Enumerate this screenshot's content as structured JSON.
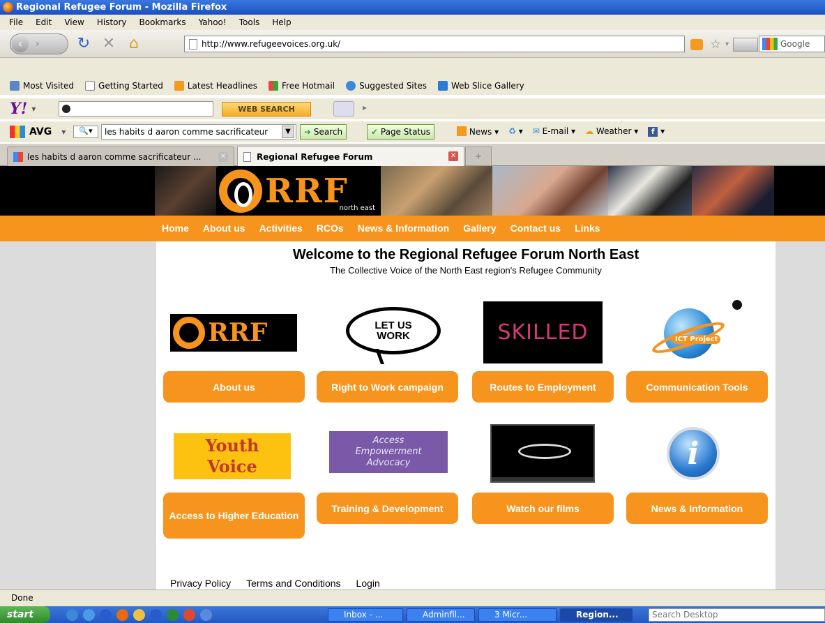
{
  "window": {
    "title": "Regional Refugee Forum - Mozilla Firefox"
  },
  "menu": [
    "File",
    "Edit",
    "View",
    "History",
    "Bookmarks",
    "Yahoo!",
    "Tools",
    "Help"
  ],
  "nav": {
    "url": "http://www.refugeevoices.org.uk/",
    "search_engine": "Google"
  },
  "bookmarks": [
    "Most Visited",
    "Getting Started",
    "Latest Headlines",
    "Free Hotmail",
    "Suggested Sites",
    "Web Slice Gallery"
  ],
  "yahoo": {
    "search_button": "WEB SEARCH"
  },
  "avg": {
    "brand": "AVG",
    "query": "les habits d aaron comme sacrificateur",
    "search_button": "Search",
    "page_status": "Page Status",
    "items": [
      "News",
      "E-mail",
      "Weather"
    ]
  },
  "tabs": [
    {
      "title": "les habits d aaron comme sacrificateur ..."
    },
    {
      "title": "Regional Refugee Forum"
    }
  ],
  "site": {
    "logo_text": "RRF",
    "logo_sub": "north east",
    "nav": [
      "Home",
      "About us",
      "Activities",
      "RCOs",
      "News & Information",
      "Gallery",
      "Contact us",
      "Links"
    ],
    "welcome": "Welcome to the Regional Refugee Forum North East",
    "tagline": "The Collective Voice of the North East region's Refugee Community",
    "tiles": [
      {
        "label": "About us"
      },
      {
        "label": "Right to Work campaign",
        "image_text": "LET US WORK"
      },
      {
        "label": "Routes to Employment",
        "image_text": "SKILLED"
      },
      {
        "label": "Communication Tools",
        "image_text": "ICT Project"
      },
      {
        "label": "Access to Higher Education",
        "image_text_1": "Youth",
        "image_text_2": "Voice"
      },
      {
        "label": "Training & Development",
        "image_text_1": "Access",
        "image_text_2": "Empowerment",
        "image_text_3": "Advocacy"
      },
      {
        "label": "Watch our films"
      },
      {
        "label": "News & Information"
      }
    ],
    "footer": [
      "Privacy Policy",
      "Terms and Conditions",
      "Login"
    ]
  },
  "status": "Done",
  "taskbar": {
    "start": "start",
    "items": [
      "Inbox - ...",
      "Adminfil...",
      "3 Micr...",
      "Region..."
    ],
    "search_placeholder": "Search Desktop"
  },
  "colors": {
    "orange": "#f7941d",
    "black": "#000000"
  }
}
